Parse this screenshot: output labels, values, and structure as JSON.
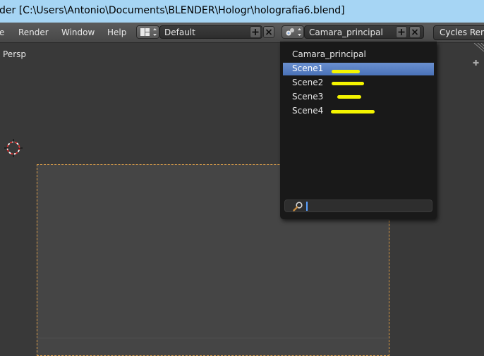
{
  "window": {
    "title": "der [C:\\Users\\Antonio\\Documents\\BLENDER\\Hologr\\holografia6.blend]"
  },
  "menubar": {
    "items": [
      "e",
      "Render",
      "Window",
      "Help"
    ],
    "layout_name": "Default",
    "scene_name": "Camara_principal",
    "render_engine": "Cycles Render"
  },
  "viewport": {
    "view_label": "Persp"
  },
  "scene_dropdown": {
    "items": [
      {
        "label": "Camara_principal",
        "selected": false,
        "highlighted": false
      },
      {
        "label": "Scene1",
        "selected": true,
        "highlighted": true
      },
      {
        "label": "Scene2",
        "selected": false,
        "highlighted": true
      },
      {
        "label": "Scene3",
        "selected": false,
        "highlighted": true
      },
      {
        "label": "Scene4",
        "selected": false,
        "highlighted": true
      }
    ],
    "search_value": ""
  },
  "colors": {
    "titlebar": "#a6d5f4",
    "selection": "#5a82c4",
    "highlighter": "#f4f400",
    "camera_border": "#e0a04a"
  }
}
